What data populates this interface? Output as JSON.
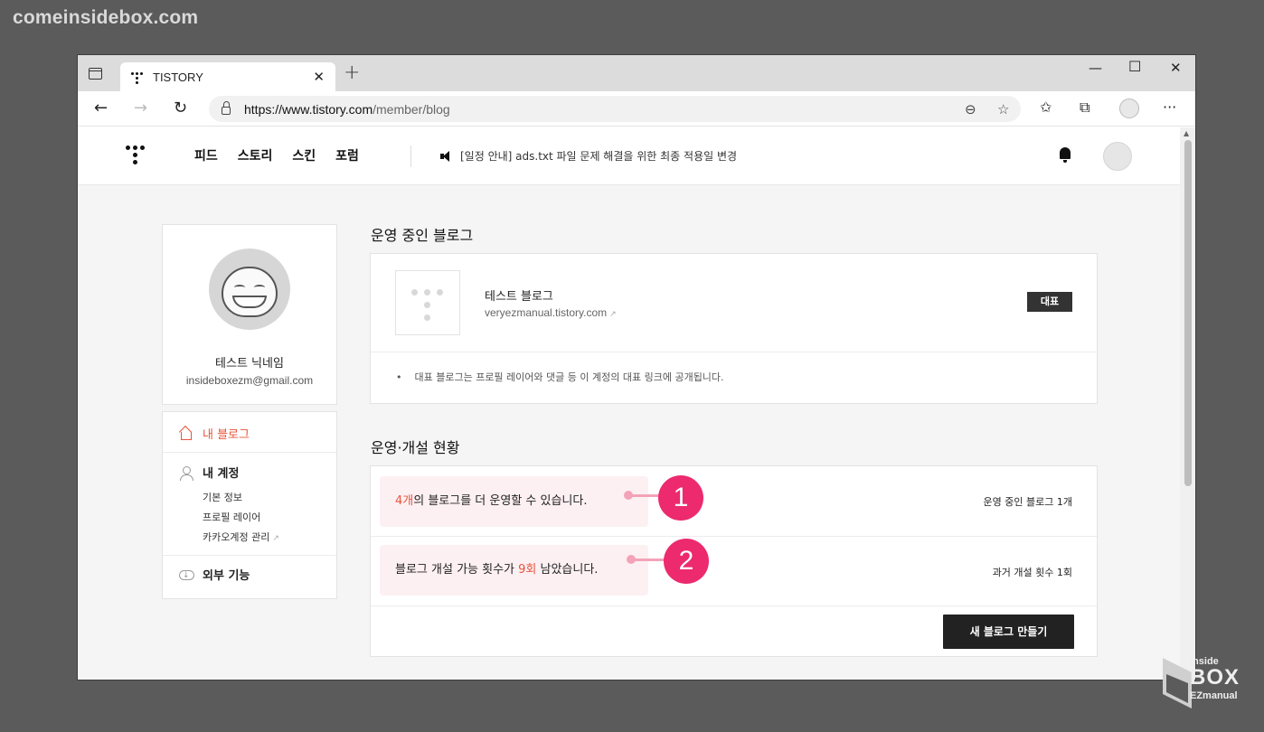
{
  "watermark": {
    "top_left": "comeinsidebox.com"
  },
  "browser": {
    "tab_title": "TISTORY",
    "url_prefix": "https://www.tistory.com",
    "url_path": "/member/blog"
  },
  "header": {
    "nav": [
      "피드",
      "스토리",
      "스킨",
      "포럼"
    ],
    "notice": "[일정 안내] ads.txt 파일 문제 해결을 위한 최종 적용일 변경"
  },
  "profile": {
    "nickname": "테스트 닉네임",
    "email": "insideboxezm@gmail.com"
  },
  "menu": {
    "my_blog": "내 블로그",
    "my_account": "내 계정",
    "account_links": [
      "기본 정보",
      "프로필 레이어",
      "카카오계정 관리"
    ],
    "external": "외부 기능"
  },
  "active_blogs": {
    "title": "운영 중인 블로그",
    "blog_name": "테스트 블로그",
    "blog_url": "veryezmanual.tistory.com",
    "badge": "대표",
    "note": "대표 블로그는 프로필 레이어와 댓글 등 이 계정의 대표 링크에 공개됩니다."
  },
  "status": {
    "title": "운영·개설 현황",
    "row1": {
      "count": "4개",
      "rest": "의 블로그를 더 운영할 수 있습니다.",
      "right": "운영 중인 블로그 1개",
      "marker": "1"
    },
    "row2": {
      "prefix": "블로그 개설 가능 횟수가 ",
      "count": "9회",
      "rest": " 남았습니다.",
      "right": "과거 개설 횟수 1회",
      "marker": "2"
    },
    "create_button": "새 블로그 만들기"
  },
  "corner_logo": {
    "line1": "Inside",
    "line2": "BOX",
    "line3": "EZmanual"
  }
}
